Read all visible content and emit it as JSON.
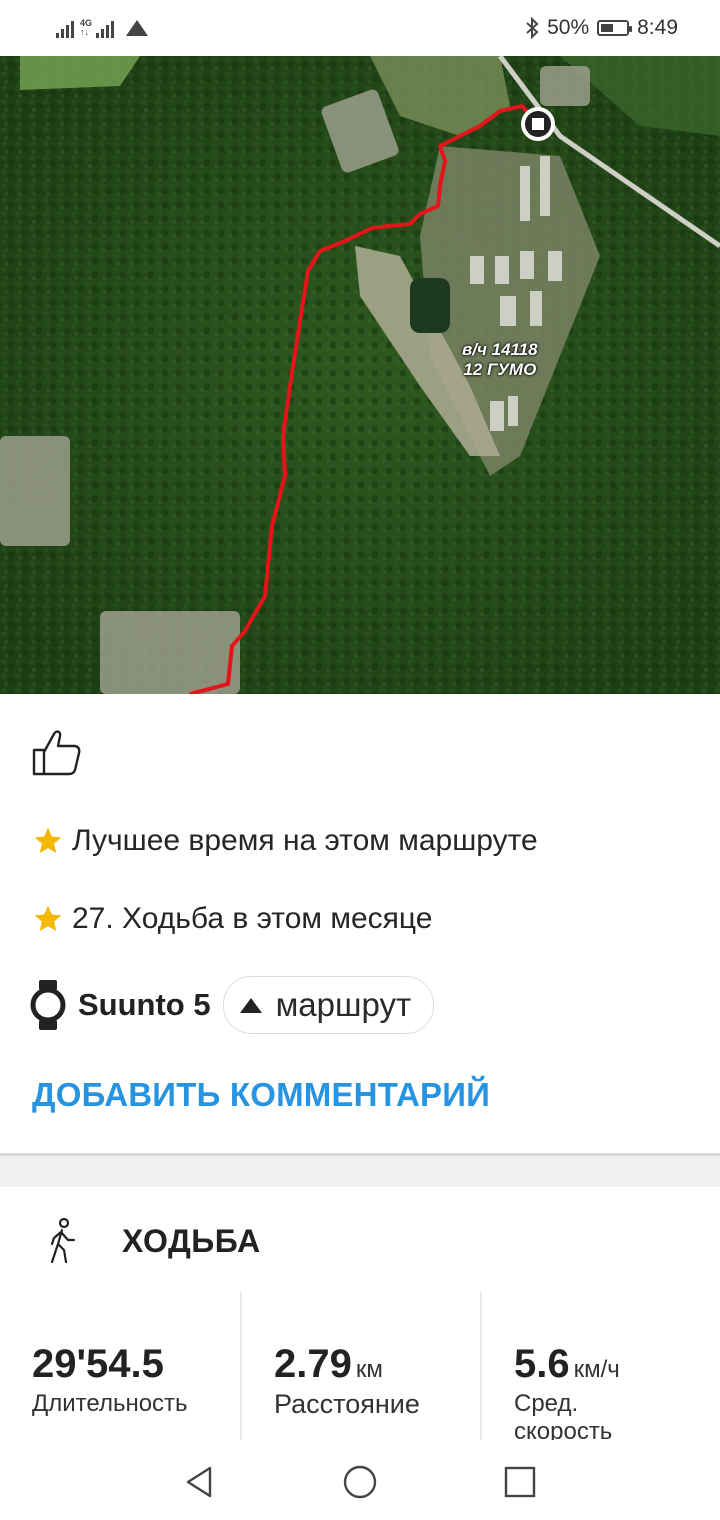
{
  "status_bar": {
    "network": "4G",
    "battery_percent": "50%",
    "battery_level": 0.5,
    "time": "8:49",
    "icons": [
      "signal-icon",
      "signal-4g-icon",
      "upload-triangle-icon",
      "bluetooth-icon",
      "battery-icon"
    ]
  },
  "map": {
    "label_line1": "в/ч 14118",
    "label_line2": "12 ГУМО",
    "route_color": "#e3141a",
    "end_marker_icon": "stop-icon"
  },
  "like_icon": "thumbs-up-icon",
  "achievements": [
    {
      "icon": "star-icon",
      "text": "Лучшее время на этом маршруте"
    },
    {
      "icon": "star-icon",
      "text": "27. Ходьба в этом месяце"
    }
  ],
  "device": {
    "icon": "watch-icon",
    "name": "Suunto 5",
    "route_button": "маршрут"
  },
  "add_comment": "ДОБАВИТЬ КОММЕНТАРИЙ",
  "activity": {
    "icon": "walking-icon",
    "title": "ХОДЬБА",
    "stats": [
      {
        "value": "29'54.5",
        "unit": "",
        "label": "Длительность"
      },
      {
        "value": "2.79",
        "unit": "км",
        "label": "Расстояние"
      },
      {
        "value": "5.6",
        "unit": "км/ч",
        "label": "Сред. скорость"
      }
    ]
  },
  "colors": {
    "accent": "#2794e2",
    "star": "#f5b800"
  },
  "nav": [
    "back-icon",
    "home-icon",
    "recents-icon"
  ]
}
